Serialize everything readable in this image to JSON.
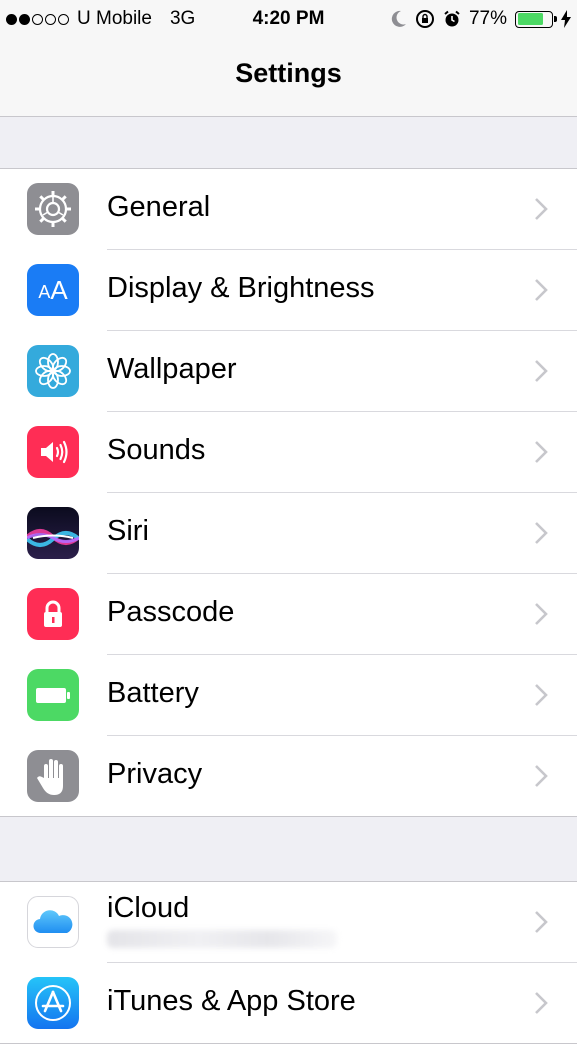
{
  "status_bar": {
    "carrier": "U Mobile",
    "network": "3G",
    "time": "4:20 PM",
    "battery_percent": "77%",
    "battery_level": 0.77,
    "signal_bars_filled": 2,
    "signal_bars_total": 5
  },
  "navbar": {
    "title": "Settings"
  },
  "groups": [
    {
      "items": [
        {
          "label": "General",
          "icon": "gear-icon",
          "color": "#8e8e93"
        },
        {
          "label": "Display & Brightness",
          "icon": "text-size-icon",
          "color": "#1a7cf5"
        },
        {
          "label": "Wallpaper",
          "icon": "flower-icon",
          "color": "#34aadc"
        },
        {
          "label": "Sounds",
          "icon": "speaker-icon",
          "color": "#ff2d55"
        },
        {
          "label": "Siri",
          "icon": "siri-icon",
          "color": "#1c1c3a"
        },
        {
          "label": "Passcode",
          "icon": "lock-icon",
          "color": "#ff2d55"
        },
        {
          "label": "Battery",
          "icon": "battery-icon",
          "color": "#4cd964"
        },
        {
          "label": "Privacy",
          "icon": "hand-icon",
          "color": "#8e8e93"
        }
      ]
    },
    {
      "items": [
        {
          "label": "iCloud",
          "icon": "cloud-icon",
          "color": "#ffffff"
        },
        {
          "label": "iTunes & App Store",
          "icon": "app-store-icon",
          "color": "#1a8cf5"
        }
      ]
    }
  ]
}
